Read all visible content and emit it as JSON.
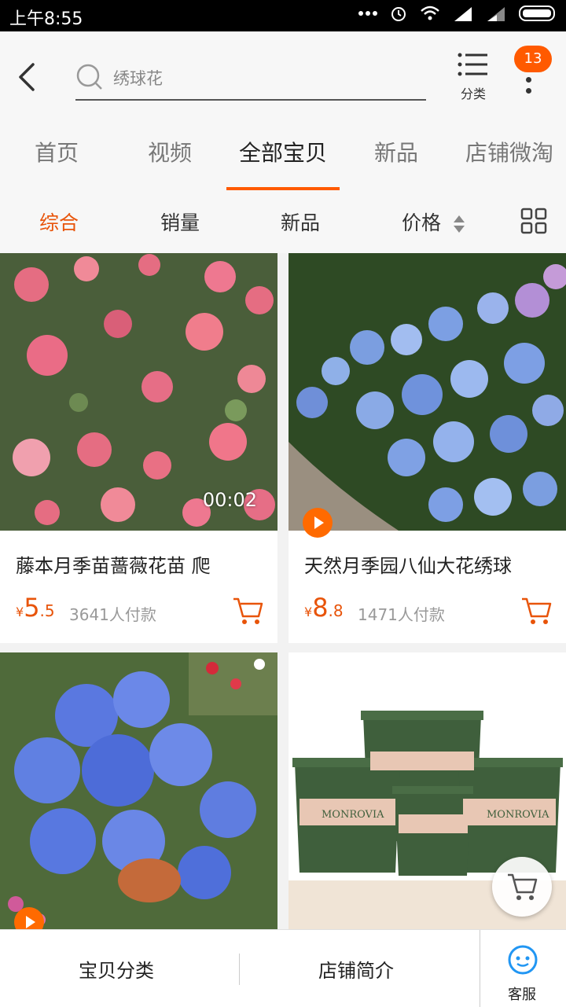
{
  "status_bar": {
    "time": "上午8:55"
  },
  "header": {
    "search_placeholder": "绣球花",
    "category_label": "分类",
    "badge_count": "13"
  },
  "tabs": [
    {
      "label": "首页"
    },
    {
      "label": "视频"
    },
    {
      "label": "全部宝贝",
      "active": true
    },
    {
      "label": "新品"
    },
    {
      "label": "店铺微淘"
    }
  ],
  "sort": {
    "items": [
      "综合",
      "销量",
      "新品",
      "价格"
    ],
    "active": "综合"
  },
  "products": [
    {
      "title": "藤本月季苗蔷薇花苗 爬",
      "currency": "¥",
      "price_int": "5",
      "price_dec": ".5",
      "sales": "3641人付款",
      "video_duration": "00:02"
    },
    {
      "title": "天然月季园八仙大花绣球",
      "currency": "¥",
      "price_int": "8",
      "price_dec": ".8",
      "sales": "1471人付款"
    },
    {
      "title": "",
      "currency": "",
      "price_int": "",
      "price_dec": "",
      "sales": ""
    },
    {
      "title": "",
      "currency": "",
      "price_int": "",
      "price_dec": "",
      "sales": "",
      "pot_brand": "MONROVIA"
    }
  ],
  "bottom_bar": {
    "left": "宝贝分类",
    "middle": "店铺简介",
    "right": "客服"
  },
  "colors": {
    "accent": "#ff5a00",
    "price": "#e8540a"
  }
}
